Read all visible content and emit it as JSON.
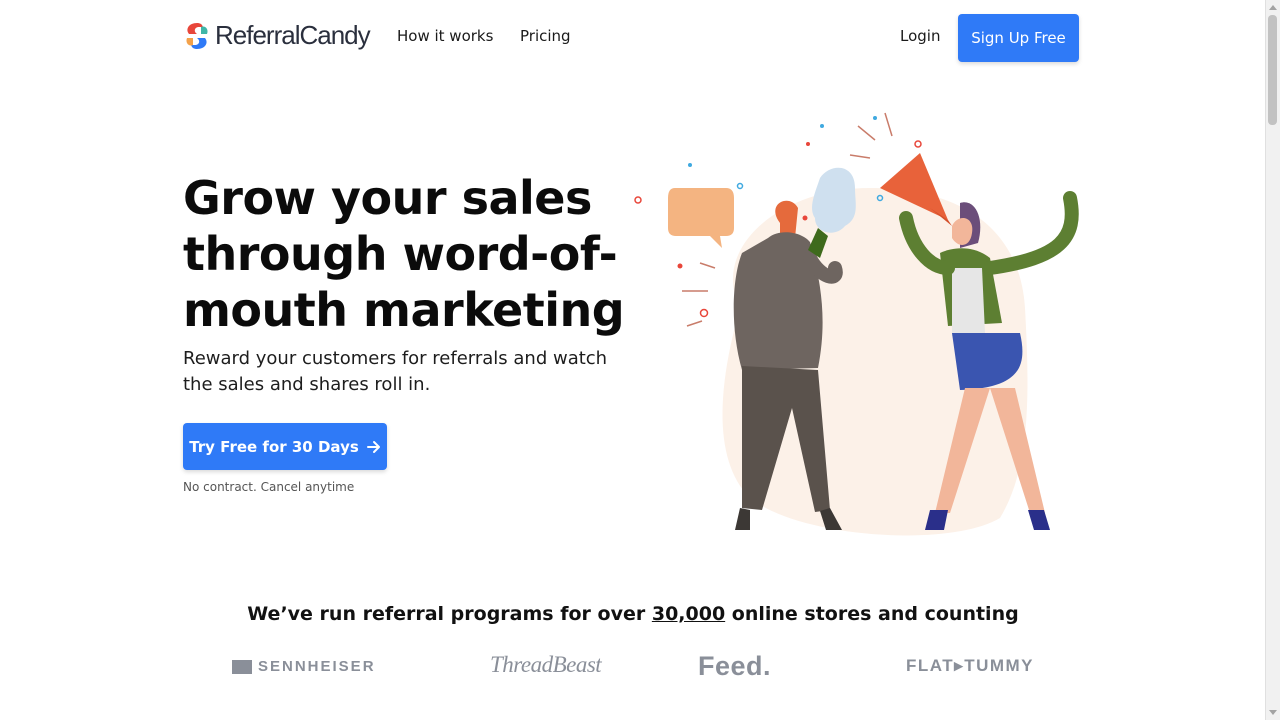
{
  "brand": {
    "name": "ReferralCandy",
    "colors": {
      "accent": "#2f7af7",
      "logo_red": "#e8463a",
      "logo_blue": "#2f7af7"
    }
  },
  "nav": {
    "how_it_works": "How it works",
    "pricing": "Pricing",
    "login": "Login",
    "signup": "Sign Up Free"
  },
  "hero": {
    "title": "Grow your sales through word-of-mouth marketing",
    "subtitle": "Reward your customers for referrals and watch the sales and shares roll in.",
    "cta_label": "Try Free for 30 Days",
    "cta_icon": "arrow-right-icon",
    "note": "No contract. Cancel anytime"
  },
  "proof": {
    "text_before": "We’ve run referral programs for over ",
    "count": "30,000",
    "text_after": " online stores and counting"
  },
  "logos": {
    "sennheiser": "SENNHEISER",
    "threadbeast": "ThreadBeast",
    "feed": "Feed.",
    "flattummy": "FLAT▸TUMMY"
  }
}
